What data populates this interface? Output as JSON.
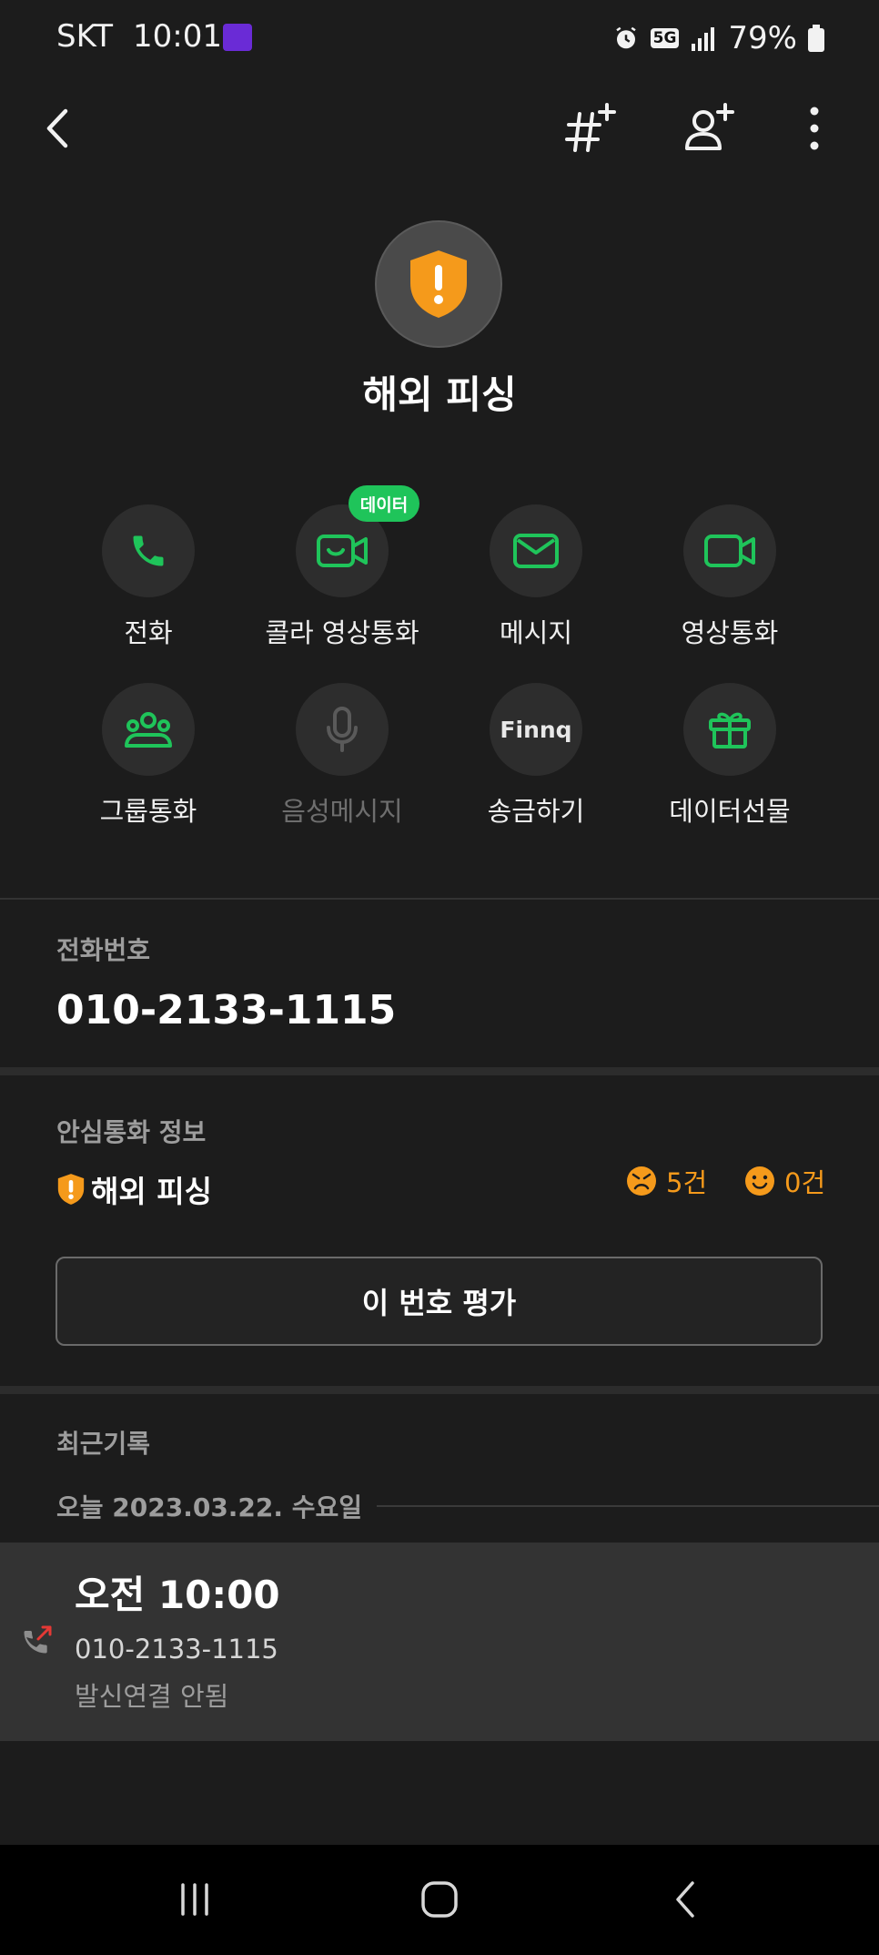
{
  "status_bar": {
    "carrier": "SKT",
    "time": "10:01",
    "network": "5G",
    "battery": "79%"
  },
  "contact": {
    "name": "해외 피싱"
  },
  "actions": [
    {
      "label": "전화",
      "icon": "phone-icon",
      "enabled": true
    },
    {
      "label": "콜라 영상통화",
      "icon": "video-chat-icon",
      "enabled": true,
      "badge": "데이터"
    },
    {
      "label": "메시지",
      "icon": "message-icon",
      "enabled": true
    },
    {
      "label": "영상통화",
      "icon": "video-call-icon",
      "enabled": true
    },
    {
      "label": "그룹통화",
      "icon": "group-icon",
      "enabled": true
    },
    {
      "label": "음성메시지",
      "icon": "microphone-icon",
      "enabled": false
    },
    {
      "label": "송금하기",
      "icon": "finnq-logo",
      "logo_text": "Finnq",
      "enabled": true
    },
    {
      "label": "데이터선물",
      "icon": "gift-icon",
      "enabled": true
    }
  ],
  "phone_section": {
    "label": "전화번호",
    "number": "010-2133-1115"
  },
  "safe_call": {
    "label": "안심통화 정보",
    "category": "해외 피싱",
    "negative_count": "5건",
    "positive_count": "0건",
    "rate_button": "이 번호 평가"
  },
  "recent": {
    "label": "최근기록",
    "date": "오늘 2023.03.22. 수요일",
    "items": [
      {
        "time": "오전 10:00",
        "number": "010-2133-1115",
        "status": "발신연결 안됨"
      }
    ]
  },
  "colors": {
    "accent_green": "#1fc45a",
    "warning_orange": "#f59a1b",
    "background": "#1c1c1c"
  }
}
